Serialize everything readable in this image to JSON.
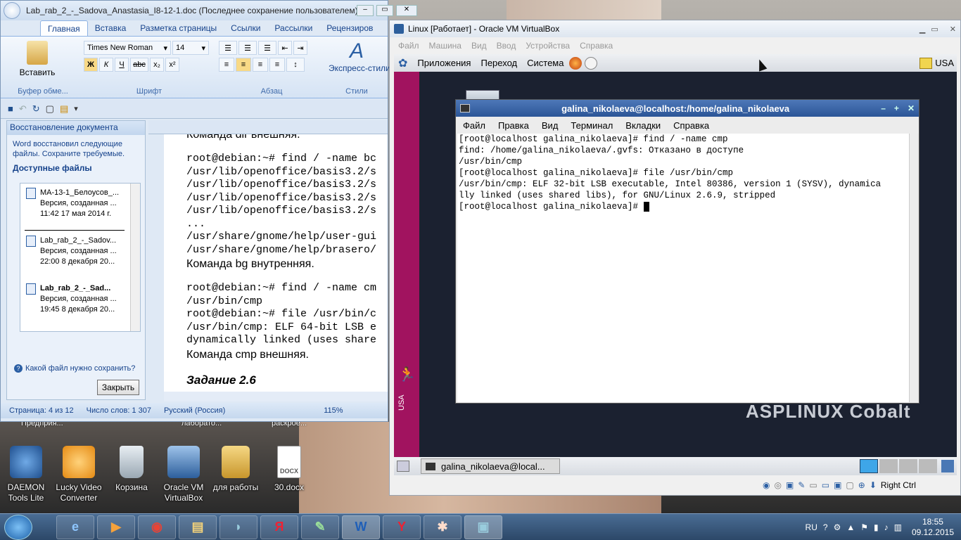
{
  "desktop": {
    "icons": [
      {
        "label": "DAEMON Tools Lite"
      },
      {
        "label": "Lucky Video Converter"
      },
      {
        "label": "Корзина"
      },
      {
        "label": "Oracle VM VirtualBox"
      },
      {
        "label": "для работы"
      },
      {
        "label": "30.docx"
      }
    ],
    "hidden_labels": [
      "Предприя...",
      "лаборато...",
      "раскрое..."
    ]
  },
  "word": {
    "title": "Lab_rab_2_-_Sadova_Anastasia_I8-12-1.doc (Последнее сохранение пользователем) [Режим огра...",
    "tabs": [
      "Главная",
      "Вставка",
      "Разметка страницы",
      "Ссылки",
      "Рассылки",
      "Рецензиров"
    ],
    "font_name": "Times New Roman",
    "font_size": "14",
    "paste_label": "Вставить",
    "styles_label": "Экспресс-стили",
    "groups": [
      "Буфер обме...",
      "Шрифт",
      "Абзац",
      "Стили"
    ],
    "recovery": {
      "header": "Восстановление документа",
      "info": "Word восстановил следующие файлы.  Сохраните требуемые.",
      "available": "Доступные файлы",
      "files": [
        {
          "name": "МА-13-1_Белоусов_...",
          "kind": "Версия, созданная ...",
          "date": "11:42 17 мая 2014 г."
        },
        {
          "name": "Lab_rab_2_-_Sadov...",
          "kind": "Версия, созданная ...",
          "date": "22:00 8 декабря 20..."
        },
        {
          "name": "Lab_rab_2_-_Sad...",
          "kind": "Версия, созданная ...",
          "date": "19:45 8 декабря 20..."
        }
      ],
      "help": "Какой файл нужно сохранить?",
      "close": "Закрыть"
    },
    "doc_lines": [
      {
        "t": "Команда dir внешняя.",
        "k": "b"
      },
      {
        "t": "root@debian:~# find / -name bc",
        "k": "m"
      },
      {
        "t": "/usr/lib/openoffice/basis3.2/s",
        "k": "m"
      },
      {
        "t": "/usr/lib/openoffice/basis3.2/s",
        "k": "m"
      },
      {
        "t": "/usr/lib/openoffice/basis3.2/s",
        "k": "m"
      },
      {
        "t": "/usr/lib/openoffice/basis3.2/s",
        "k": "m"
      },
      {
        "t": "...",
        "k": "m"
      },
      {
        "t": "/usr/share/gnome/help/user-gui",
        "k": "m"
      },
      {
        "t": "/usr/share/gnome/help/brasero/",
        "k": "m"
      },
      {
        "t": "Команда bg внутренняя.",
        "k": "b"
      },
      {
        "t": "root@debian:~# find / -name cm",
        "k": "m"
      },
      {
        "t": "/usr/bin/cmp",
        "k": "m"
      },
      {
        "t": "root@debian:~# file /usr/bin/c",
        "k": "m"
      },
      {
        "t": "/usr/bin/cmp: ELF 64-bit LSB e",
        "k": "m"
      },
      {
        "t": "dynamically linked (uses share",
        "k": "m"
      },
      {
        "t": "Команда cmp внешняя.",
        "k": "b"
      },
      {
        "t": "Задание 2.6",
        "k": "h"
      }
    ],
    "status": {
      "page": "Страница: 4 из 12",
      "words": "Число слов: 1 307",
      "lang": "Русский (Россия)",
      "zoom": "115%"
    }
  },
  "vbox": {
    "title": "Linux [Работает] - Oracle VM VirtualBox",
    "menu": [
      "Файл",
      "Машина",
      "Вид",
      "Ввод",
      "Устройства",
      "Справка"
    ],
    "guest_menu": [
      "Приложения",
      "Переход",
      "Система"
    ],
    "kbd": "USA",
    "host_key": "Right Ctrl",
    "brand": "ASPLINUX Cobalt",
    "task_item": "galina_nikolaeva@local...",
    "side_label": "USA",
    "terminal": {
      "title": "galina_nikolaeva@localhost:/home/galina_nikolaeva",
      "menu": [
        "Файл",
        "Правка",
        "Вид",
        "Терминал",
        "Вкладки",
        "Справка"
      ],
      "lines": [
        "[root@localhost galina_nikolaeva]# find / -name cmp",
        "find: /home/galina_nikolaeva/.gvfs: Отказано в доступе",
        "/usr/bin/cmp",
        "[root@localhost galina_nikolaeva]# file /usr/bin/cmp",
        "/usr/bin/cmp: ELF 32-bit LSB executable, Intel 80386, version 1 (SYSV), dynamica",
        "lly linked (uses shared libs), for GNU/Linux 2.6.9, stripped",
        "[root@localhost galina_nikolaeva]# "
      ]
    }
  },
  "tray": {
    "lang": "RU",
    "time": "18:55",
    "date": "09.12.2015"
  }
}
